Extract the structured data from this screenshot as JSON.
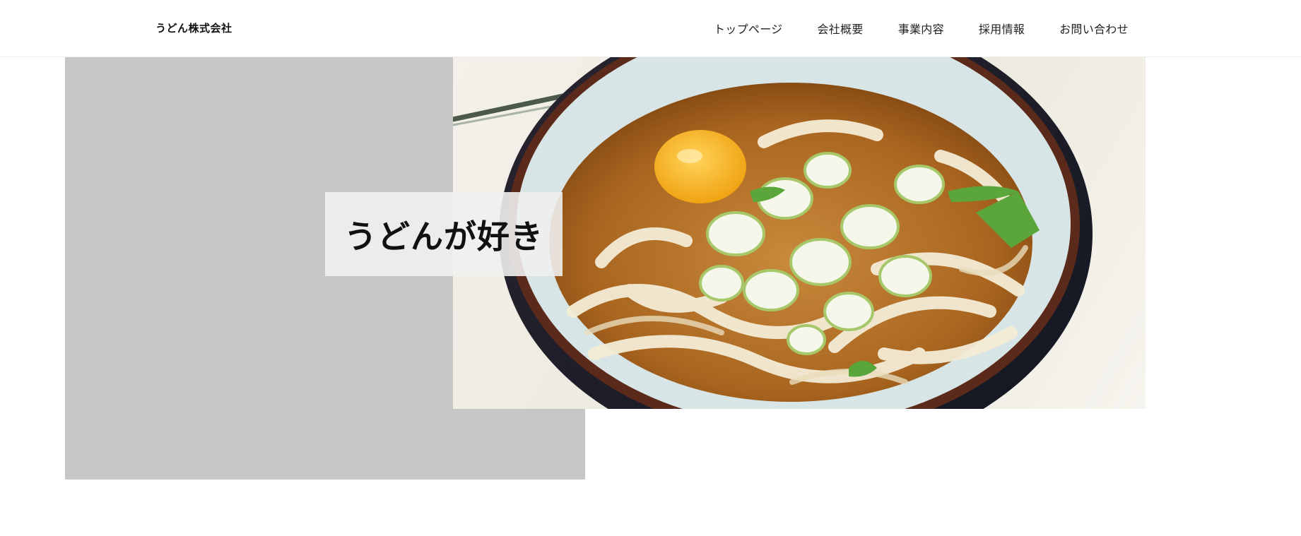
{
  "header": {
    "logo": "うどん株式会社",
    "nav": [
      {
        "label": "トップページ"
      },
      {
        "label": "会社概要"
      },
      {
        "label": "事業内容"
      },
      {
        "label": "採用情報"
      },
      {
        "label": "お問い合わせ"
      }
    ]
  },
  "hero": {
    "title": "うどんが好き",
    "image_subject": "udon-bowl-photo",
    "colors": {
      "gray_block": "#c6c6c6",
      "title_box": "#f0f0f0"
    }
  }
}
